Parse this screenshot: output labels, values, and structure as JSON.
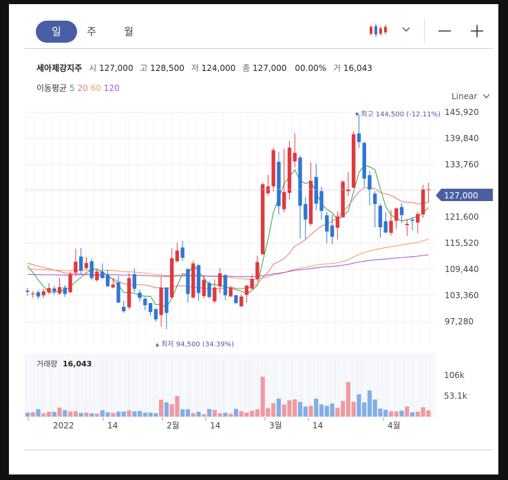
{
  "tabs": [
    {
      "label": "일"
    },
    {
      "label": "주"
    },
    {
      "label": "월"
    }
  ],
  "toolbar": {
    "chart_type_icon": "candlestick-icon",
    "dropdown_icon": "chevron-down-icon",
    "zoom_out_icon": "minus-icon",
    "zoom_in_icon": "plus-icon"
  },
  "stock": {
    "name": "세아제강지주",
    "open_label": "시",
    "open": "127,000",
    "high_label": "고",
    "high": "128,500",
    "low_label": "저",
    "low": "124,000",
    "close_label": "종",
    "close": "127,000",
    "change": "0",
    "change_pct": "0.00%",
    "volume_label": "거",
    "volume": "16,043"
  },
  "ma": {
    "label": "이동평균",
    "p5": "5",
    "p20": "20",
    "p60": "60",
    "p120": "120"
  },
  "scale_label": "Linear",
  "price_axis": [
    "145,920",
    "139,840",
    "133,760",
    "127,000",
    "121,600",
    "115,520",
    "109,440",
    "103,360",
    "97,280"
  ],
  "high_marker": {
    "label": "최고",
    "value": "144,500",
    "pct": "(-12.11%)"
  },
  "low_marker": {
    "label": "최저",
    "value": "94,500",
    "pct": "(34.39%)"
  },
  "volume_panel": {
    "label": "거래량",
    "value": "16,043",
    "ticks": [
      "106k",
      "53.1k"
    ]
  },
  "date_axis": [
    "2022",
    "14",
    "2월",
    "14",
    "3월",
    "14",
    "4월"
  ],
  "colors": {
    "up": "#e0393e",
    "down": "#2f77d1",
    "ma5": "#3ca94c",
    "ma20": "#e77b7b",
    "ma60": "#f2a15f",
    "ma120": "#a25be0",
    "accent": "#4a5fa3"
  },
  "chart_data": {
    "type": "candlestick",
    "candles": [
      [
        103500,
        103200,
        104100,
        102300
      ],
      [
        102600,
        102800,
        103400,
        101800
      ],
      [
        103100,
        102100,
        103600,
        101500
      ],
      [
        102400,
        103300,
        103900,
        101800
      ],
      [
        103100,
        104100,
        105200,
        102600
      ],
      [
        104000,
        103300,
        104600,
        102500
      ],
      [
        102800,
        104300,
        106500,
        102500
      ],
      [
        104200,
        102700,
        104800,
        102000
      ],
      [
        103100,
        107300,
        107900,
        102900
      ],
      [
        107700,
        110200,
        113200,
        106900
      ],
      [
        111400,
        108100,
        113400,
        107400
      ],
      [
        108700,
        109900,
        111300,
        108400
      ],
      [
        110300,
        106400,
        110900,
        105900
      ],
      [
        105900,
        107900,
        108400,
        105600
      ],
      [
        107900,
        106400,
        109800,
        106200
      ],
      [
        107200,
        104500,
        108300,
        104300
      ],
      [
        104200,
        104900,
        106400,
        104000
      ],
      [
        105400,
        100700,
        106900,
        100600
      ],
      [
        99700,
        98700,
        101100,
        98300
      ],
      [
        99600,
        106400,
        107600,
        99100
      ],
      [
        107300,
        103900,
        108600,
        103200
      ],
      [
        103000,
        101800,
        103800,
        100900
      ],
      [
        101600,
        100100,
        102000,
        98900
      ],
      [
        100600,
        98500,
        100600,
        97600
      ],
      [
        99200,
        96800,
        99300,
        96300
      ],
      [
        97800,
        104100,
        106700,
        95100
      ],
      [
        104200,
        98300,
        104300,
        94500
      ],
      [
        101900,
        111000,
        113300,
        101600
      ],
      [
        110300,
        112800,
        114600,
        110100
      ],
      [
        113500,
        111100,
        115100,
        110400
      ],
      [
        108500,
        102700,
        108600,
        100700
      ],
      [
        101900,
        109800,
        110400,
        101600
      ],
      [
        109400,
        102900,
        109600,
        101100
      ],
      [
        102200,
        106000,
        106900,
        101700
      ],
      [
        105300,
        102000,
        105700,
        101700
      ],
      [
        101000,
        104200,
        106100,
        100600
      ],
      [
        104500,
        107500,
        108700,
        102800
      ],
      [
        107100,
        102400,
        107300,
        101300
      ],
      [
        102100,
        104100,
        104600,
        103400
      ],
      [
        102400,
        100600,
        102600,
        100300
      ],
      [
        99800,
        102100,
        102600,
        99800
      ],
      [
        102500,
        104600,
        104900,
        100700
      ],
      [
        103900,
        106200,
        107200,
        103900
      ],
      [
        106200,
        110100,
        111600,
        105800
      ],
      [
        111900,
        128200,
        128500,
        111900
      ],
      [
        126100,
        127700,
        130400,
        125500
      ],
      [
        127700,
        136100,
        136700,
        126500
      ],
      [
        133400,
        123100,
        135700,
        121200
      ],
      [
        122400,
        126400,
        136400,
        121700
      ],
      [
        126200,
        136700,
        138300,
        124700
      ],
      [
        133500,
        135500,
        140000,
        132100
      ],
      [
        134400,
        123200,
        134800,
        115600
      ],
      [
        123600,
        120000,
        125300,
        115400
      ],
      [
        119000,
        129000,
        133300,
        118500
      ],
      [
        129900,
        123700,
        133000,
        122100
      ],
      [
        126600,
        122000,
        127600,
        119900
      ],
      [
        121000,
        117200,
        121800,
        114500
      ],
      [
        118600,
        116000,
        121100,
        114300
      ],
      [
        118100,
        120700,
        121900,
        115400
      ],
      [
        120500,
        128800,
        129100,
        120500
      ],
      [
        126600,
        127000,
        131000,
        125400
      ],
      [
        127400,
        139800,
        140500,
        127300
      ],
      [
        140000,
        138000,
        144500,
        136600
      ],
      [
        137800,
        129500,
        138100,
        127700
      ],
      [
        130300,
        126900,
        131200,
        123300
      ],
      [
        126000,
        123600,
        126600,
        118200
      ],
      [
        123200,
        118200,
        123700,
        115800
      ],
      [
        119600,
        117000,
        121800,
        116800
      ],
      [
        116900,
        119700,
        122200,
        116300
      ],
      [
        119700,
        122600,
        122800,
        117800
      ],
      [
        122900,
        121000,
        123800,
        119200
      ],
      [
        118700,
        119000,
        120100,
        116200
      ],
      [
        120000,
        119700,
        120400,
        117500
      ],
      [
        119300,
        121300,
        121800,
        116800
      ],
      [
        121200,
        127000,
        128100,
        120400
      ],
      [
        127000,
        127000,
        128500,
        124000
      ]
    ],
    "volume": [
      6200,
      7000,
      11600,
      5200,
      7500,
      7200,
      14000,
      10000,
      8100,
      8300,
      5800,
      6100,
      5100,
      4700,
      9900,
      6800,
      5900,
      7800,
      7900,
      9600,
      8300,
      8800,
      6100,
      6400,
      5400,
      26100,
      22000,
      19100,
      31900,
      11400,
      11300,
      5500,
      7600,
      3600,
      11800,
      10400,
      5200,
      6100,
      4500,
      12000,
      8200,
      6300,
      9100,
      11300,
      61600,
      13200,
      20600,
      27900,
      18800,
      25200,
      26600,
      22800,
      15600,
      16900,
      27700,
      18800,
      16800,
      20400,
      13600,
      24100,
      53300,
      23000,
      34600,
      22100,
      40300,
      26400,
      12400,
      10600,
      8200,
      8000,
      9200,
      15800,
      6700,
      7700,
      14500,
      9800
    ]
  }
}
